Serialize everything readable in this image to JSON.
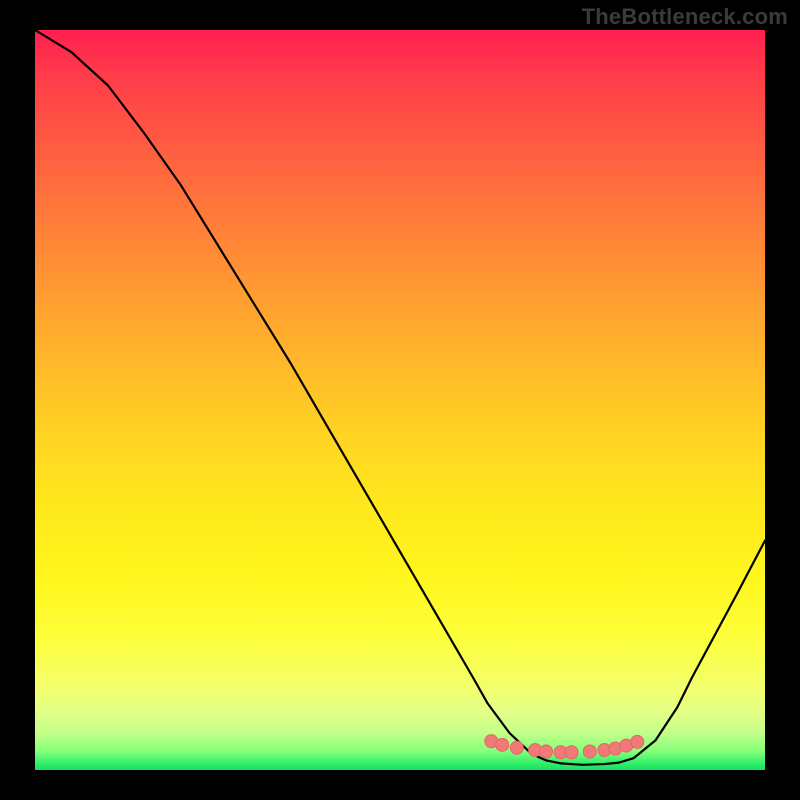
{
  "watermark": "TheBottleneck.com",
  "colors": {
    "frame": "#000000",
    "curve": "#000000",
    "markerFill": "#f17a78",
    "markerStroke": "#e46664"
  },
  "chart_data": {
    "type": "line",
    "title": "",
    "xlabel": "",
    "ylabel": "",
    "xlim": [
      0,
      100
    ],
    "ylim": [
      0,
      100
    ],
    "grid": false,
    "legend": false,
    "series": [
      {
        "name": "bottleneck-curve",
        "x": [
          0,
          5,
          10,
          15,
          20,
          25,
          30,
          35,
          40,
          45,
          50,
          55,
          60,
          62,
          65,
          68,
          70,
          72,
          75,
          78,
          80,
          82,
          85,
          88,
          90,
          93,
          96,
          100
        ],
        "y": [
          100,
          97,
          92.5,
          86,
          79,
          71,
          63,
          55,
          46.5,
          38,
          29.5,
          21,
          12.5,
          9,
          5,
          2.2,
          1.3,
          0.9,
          0.7,
          0.8,
          1.0,
          1.6,
          4,
          8.5,
          12.5,
          18,
          23.5,
          31
        ]
      }
    ],
    "markers": {
      "name": "optimal-range",
      "x": [
        62.5,
        64,
        66,
        68.5,
        70,
        72,
        73.5,
        76,
        78,
        79.5,
        81,
        82.5
      ],
      "y": [
        3.9,
        3.4,
        3.0,
        2.7,
        2.5,
        2.4,
        2.4,
        2.5,
        2.7,
        2.9,
        3.3,
        3.8
      ]
    }
  }
}
